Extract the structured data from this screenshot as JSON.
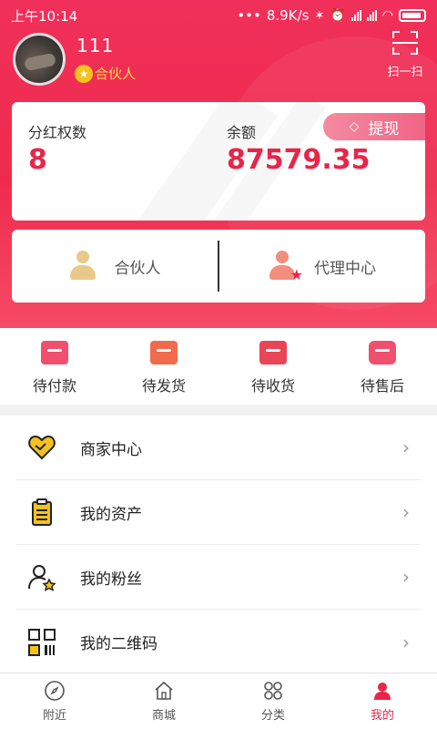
{
  "status_bar": {
    "time": "上午10:14",
    "dots": "•••",
    "network_speed": "8.9K/s"
  },
  "profile": {
    "username": "111",
    "level_label": "合伙人",
    "scan_label": "扫一扫"
  },
  "balance": {
    "dividend_label": "分红权数",
    "dividend_value": "8",
    "balance_label": "余额",
    "balance_value": "87579.35",
    "withdraw_label": "提现"
  },
  "roles": [
    {
      "label": "合伙人",
      "icon": "partner-person-icon"
    },
    {
      "label": "代理中心",
      "icon": "agent-person-star-icon"
    }
  ],
  "orders": [
    {
      "label": "待付款",
      "icon": "wallet-icon"
    },
    {
      "label": "待发货",
      "icon": "tray-download-icon"
    },
    {
      "label": "待收货",
      "icon": "box-clock-icon"
    },
    {
      "label": "待售后",
      "icon": "chat-bubble-icon"
    }
  ],
  "menu": [
    {
      "label": "商家中心",
      "icon": "heart-handshake-icon"
    },
    {
      "label": "我的资产",
      "icon": "clipboard-icon"
    },
    {
      "label": "我的粉丝",
      "icon": "user-star-icon"
    },
    {
      "label": "我的二维码",
      "icon": "qrcode-icon"
    }
  ],
  "tabbar": [
    {
      "label": "附近",
      "icon": "compass-icon"
    },
    {
      "label": "商城",
      "icon": "house-icon"
    },
    {
      "label": "分类",
      "icon": "grid-icon"
    },
    {
      "label": "我的",
      "icon": "person-icon",
      "active": true
    }
  ],
  "colors": {
    "brand": "#ef2b4d",
    "value_red": "#e8254a",
    "gold": "#f5c21b"
  }
}
